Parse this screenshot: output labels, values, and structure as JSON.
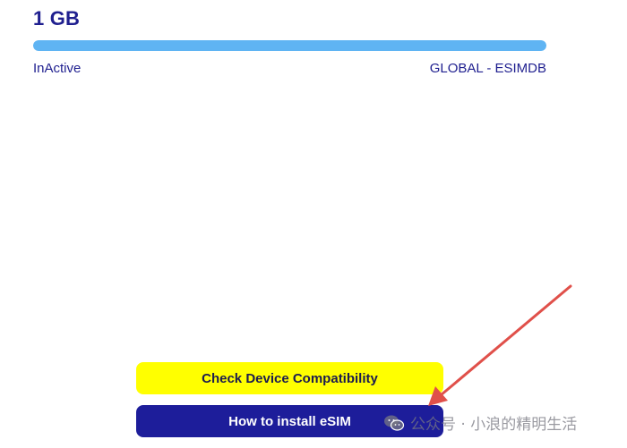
{
  "plan": {
    "data_amount": "1 GB",
    "usage_fraction": 1.0,
    "status": "InActive",
    "name": "GLOBAL - ESIMDB"
  },
  "actions": {
    "check_compatibility_label": "Check Device Compatibility",
    "install_label": "How to install eSIM"
  },
  "watermark": {
    "text": "公众号 · 小浪的精明生活",
    "icon": "wechat-icon"
  },
  "colors": {
    "accent_blue": "#1d1d9a",
    "progress": "#5fb4f3",
    "compat_button": "#ffff00",
    "arrow": "#e0504a"
  }
}
